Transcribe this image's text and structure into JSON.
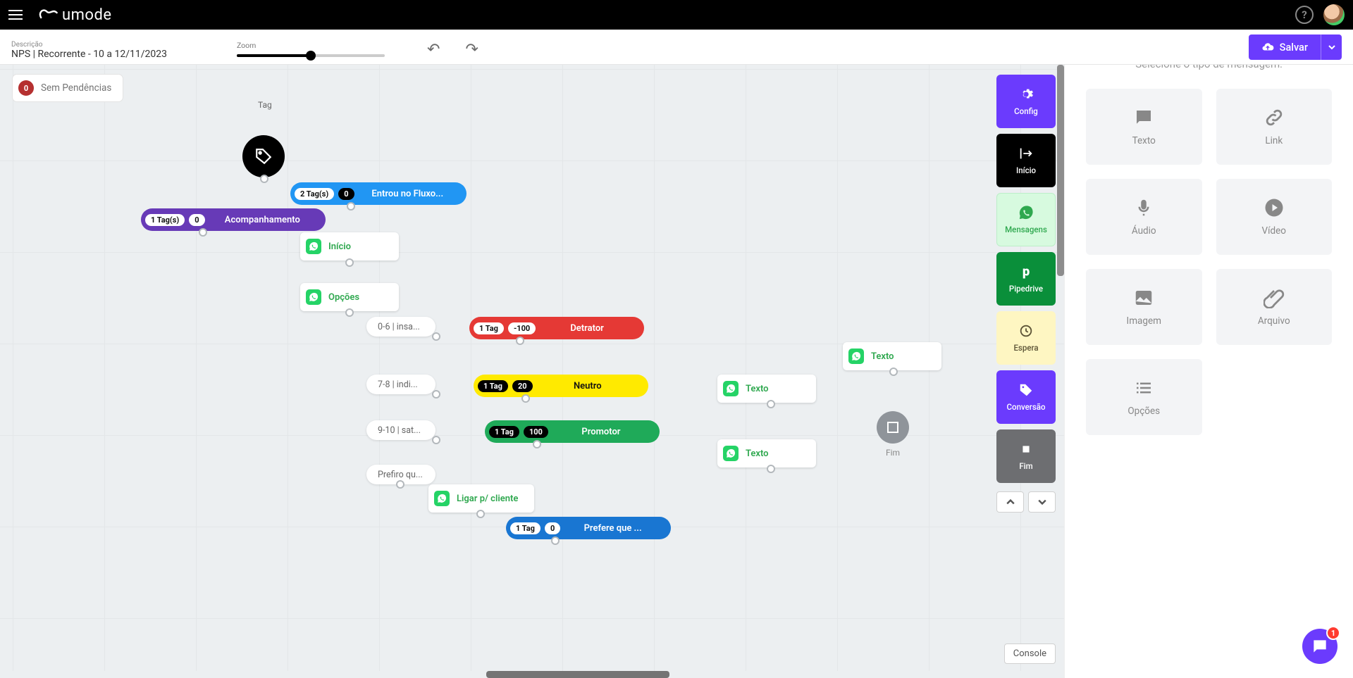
{
  "topbar": {
    "brand": "umode"
  },
  "toolbar": {
    "desc_label": "Descrição",
    "desc_value": "NPS | Recorrente - 10 a 12/11/2023",
    "zoom_label": "Zoom",
    "save_label": "Salvar"
  },
  "stage": {
    "pendencias_count": "0",
    "pendencias_text": "Sem Pendências",
    "console_btn": "Console"
  },
  "vpanel": {
    "config": "Config",
    "inicio": "Início",
    "mensagens": "Mensagens",
    "pipedrive": "Pipedrive",
    "espera": "Espera",
    "conversao": "Conversão",
    "fim": "Fim"
  },
  "msgpanel": {
    "title": "Selecione o tipo de mensagem:",
    "tiles": [
      "Texto",
      "Link",
      "Áudio",
      "Vídeo",
      "Imagem",
      "Arquivo",
      "Opções"
    ]
  },
  "nodes": {
    "tag_caption": "Tag",
    "entrou": {
      "chip1": "2 Tag(s)",
      "chip2": "0",
      "label": "Entrou no Fluxo..."
    },
    "acomp": {
      "chip1": "1 Tag(s)",
      "chip2": "0",
      "label": "Acompanhamento"
    },
    "inicio_card": "Início",
    "opcoes_card": "Opções",
    "opt1": "0-6 | insa...",
    "opt2": "7-8 | indi...",
    "opt3": "9-10 | sat...",
    "opt4": "Prefiro qu...",
    "detrator": {
      "chip1": "1 Tag",
      "chip2": "-100",
      "label": "Detrator"
    },
    "neutro": {
      "chip1": "1 Tag",
      "chip2": "20",
      "label": "Neutro"
    },
    "promotor": {
      "chip1": "1 Tag",
      "chip2": "100",
      "label": "Promotor"
    },
    "prefere": {
      "chip1": "1 Tag",
      "chip2": "0",
      "label": "Prefere que ..."
    },
    "texto": "Texto",
    "ligar": "Ligar p/ cliente",
    "fim_caption": "Fim"
  },
  "chat_badge": "1"
}
